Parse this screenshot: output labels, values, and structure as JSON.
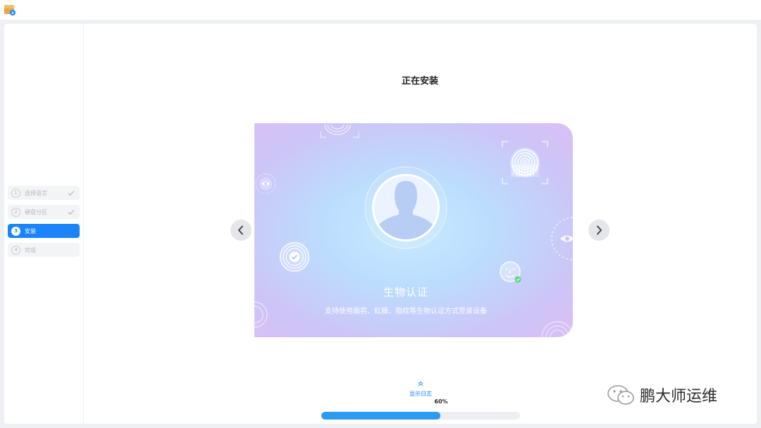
{
  "window": {
    "app_icon": "installer-app-icon"
  },
  "sidebar": {
    "steps": [
      {
        "number": "1",
        "label": "选择语言",
        "state": "done"
      },
      {
        "number": "2",
        "label": "硬盘分区",
        "state": "done"
      },
      {
        "number": "3",
        "label": "安装",
        "state": "active"
      },
      {
        "number": "4",
        "label": "完成",
        "state": "pending"
      }
    ]
  },
  "main": {
    "title": "正在安装",
    "slide": {
      "heading": "生物认证",
      "subtitle": "支持使用面容、虹膜、指纹等生物认证方式登录设备"
    },
    "log_toggle_label": "显示日志",
    "progress": {
      "percent_text": "60%",
      "value": 0.6
    }
  },
  "watermark": {
    "text": "鹏大师运维"
  },
  "colors": {
    "accent": "#1a84f8",
    "progress": "#2e9bf2"
  }
}
